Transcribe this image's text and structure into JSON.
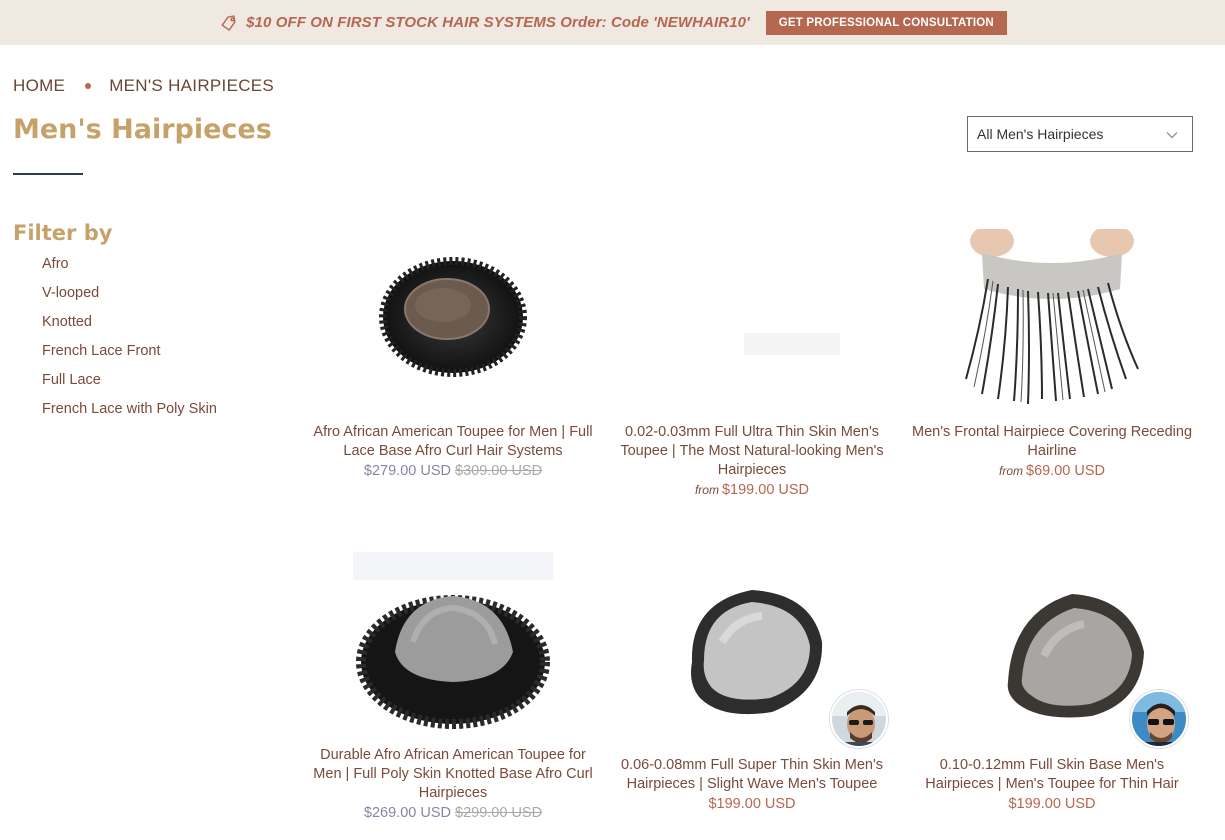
{
  "promo": {
    "text": "$10 OFF ON FIRST STOCK HAIR SYSTEMS Order: Code 'NEWHAIR10'",
    "button_label": "GET PROFESSIONAL CONSULTATION",
    "icon": "tag-icon"
  },
  "breadcrumb": {
    "home": "HOME",
    "current": "MEN'S HAIRPIECES"
  },
  "page": {
    "title": "Men's Hairpieces"
  },
  "sort_select": {
    "selected": "All Men's Hairpieces",
    "icon": "chevron-down-icon"
  },
  "filter": {
    "title": "Filter by",
    "items": [
      {
        "label": "Afro"
      },
      {
        "label": "V-looped"
      },
      {
        "label": "Knotted"
      },
      {
        "label": "French Lace Front"
      },
      {
        "label": "Full Lace"
      },
      {
        "label": "French Lace with Poly Skin"
      }
    ]
  },
  "products": [
    {
      "name": "Afro African American Toupee for Men | Full Lace Base Afro Curl Hair Systems",
      "sale_price": "$279.00 USD",
      "old_price": "$309.00 USD"
    },
    {
      "name": "0.02-0.03mm Full Ultra Thin Skin Men's Toupee | The Most Natural-looking Men's Hairpieces",
      "from_label": "from",
      "price": "$199.00 USD"
    },
    {
      "name": "Men's Frontal Hairpiece Covering Receding Hairline",
      "from_label": "from",
      "price": "$69.00 USD"
    },
    {
      "name": "Durable Afro African American Toupee for Men | Full Poly Skin Knotted Base Afro Curl Hairpieces",
      "sale_price": "$269.00 USD",
      "old_price": "$299.00 USD"
    },
    {
      "name": "0.06-0.08mm Full Super Thin Skin Men's Hairpieces | Slight Wave Men's Toupee",
      "price": "$199.00 USD"
    },
    {
      "name": "0.10-0.12mm Full Skin Base Men's Hairpieces | Men's Toupee for Thin Hair",
      "price": "$199.00 USD"
    }
  ],
  "colors": {
    "accent": "#b5674f",
    "title_gold": "#c6a26a",
    "promo_bg": "#efe9e2",
    "sale_price": "#8b82a8"
  }
}
